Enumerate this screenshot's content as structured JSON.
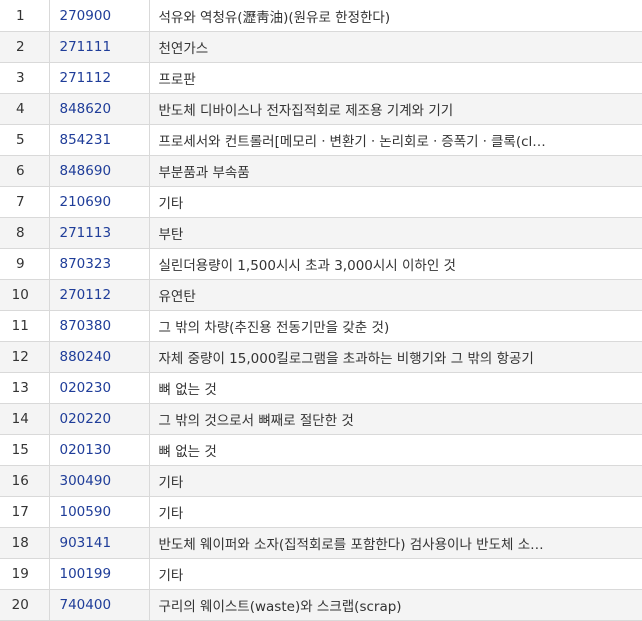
{
  "colors": {
    "code_link": "#1f3d99",
    "row_stripe": "#f4f4f4",
    "border": "#d9d9d9",
    "text": "#333333"
  },
  "rows": [
    {
      "rank": "1",
      "code": "270900",
      "name": "석유와 역청유(瀝靑油)(원유로 한정한다)"
    },
    {
      "rank": "2",
      "code": "271111",
      "name": "천연가스"
    },
    {
      "rank": "3",
      "code": "271112",
      "name": "프로판"
    },
    {
      "rank": "4",
      "code": "848620",
      "name": "반도체 디바이스나 전자집적회로 제조용 기계와 기기"
    },
    {
      "rank": "5",
      "code": "854231",
      "name": "프로세서와 컨트롤러[메모리ㆍ변환기ㆍ논리회로ㆍ증폭기ㆍ클록(cl…"
    },
    {
      "rank": "6",
      "code": "848690",
      "name": "부분품과 부속품"
    },
    {
      "rank": "7",
      "code": "210690",
      "name": "기타"
    },
    {
      "rank": "8",
      "code": "271113",
      "name": "부탄"
    },
    {
      "rank": "9",
      "code": "870323",
      "name": "실린더용량이 1,500시시 초과 3,000시시 이하인 것"
    },
    {
      "rank": "10",
      "code": "270112",
      "name": "유연탄"
    },
    {
      "rank": "11",
      "code": "870380",
      "name": "그 밖의 차량(추진용 전동기만을 갖춘 것)"
    },
    {
      "rank": "12",
      "code": "880240",
      "name": "자체 중량이 15,000킬로그램을 초과하는 비행기와 그 밖의 항공기"
    },
    {
      "rank": "13",
      "code": "020230",
      "name": "뼈 없는 것"
    },
    {
      "rank": "14",
      "code": "020220",
      "name": "그 밖의 것으로서 뼈째로 절단한 것"
    },
    {
      "rank": "15",
      "code": "020130",
      "name": "뼈 없는 것"
    },
    {
      "rank": "16",
      "code": "300490",
      "name": "기타"
    },
    {
      "rank": "17",
      "code": "100590",
      "name": "기타"
    },
    {
      "rank": "18",
      "code": "903141",
      "name": "반도체 웨이퍼와 소자(집적회로를 포함한다) 검사용이나 반도체 소…"
    },
    {
      "rank": "19",
      "code": "100199",
      "name": "기타"
    },
    {
      "rank": "20",
      "code": "740400",
      "name": "구리의 웨이스트(waste)와 스크랩(scrap)"
    }
  ]
}
